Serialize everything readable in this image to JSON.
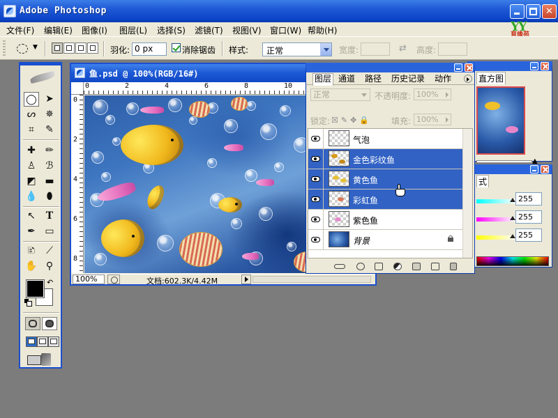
{
  "window": {
    "title": "Adobe Photoshop"
  },
  "menu": [
    "文件(F)",
    "编辑(E)",
    "图像(I)",
    "图层(L)",
    "选择(S)",
    "滤镜(T)",
    "视图(V)",
    "窗口(W)",
    "帮助(H)"
  ],
  "logo": {
    "letters": "YY",
    "text": "育缘苑"
  },
  "options": {
    "feather_label": "羽化:",
    "feather_value": "0 px",
    "antialias_label": "消除锯齿",
    "antialias_checked": true,
    "style_label": "样式:",
    "style_value": "正常",
    "width_label": "宽度:",
    "height_label": "高度:"
  },
  "document": {
    "title": "鱼.psd @ 100%(RGB/16#)",
    "ruler_h": [
      "0",
      "2",
      "4",
      "6",
      "8",
      "10"
    ],
    "ruler_v": [
      "0",
      "2",
      "4",
      "6",
      "8"
    ],
    "zoom": "100%",
    "doc_size": "文档:602.3K/4.42M"
  },
  "layers_panel": {
    "tabs": [
      "图层",
      "通道",
      "路径",
      "历史记录",
      "动作"
    ],
    "active_tab": "图层",
    "blend_mode": "正常",
    "opacity_label": "不透明度:",
    "opacity_value": "100%",
    "lock_label": "锁定:",
    "fill_label": "填充:",
    "fill_value": "100%",
    "layers": [
      {
        "name": "气泡",
        "selected": false,
        "visible": true
      },
      {
        "name": "金色彩纹鱼",
        "selected": true,
        "visible": true
      },
      {
        "name": "黄色鱼",
        "selected": true,
        "visible": true
      },
      {
        "name": "彩虹鱼",
        "selected": true,
        "visible": true
      },
      {
        "name": "紫色鱼",
        "selected": false,
        "visible": true
      },
      {
        "name": "背景",
        "selected": false,
        "visible": true,
        "locked": true
      }
    ]
  },
  "navigator_panel": {
    "tab": "直方图"
  },
  "color_panel": {
    "tab_fragment": "式",
    "r": "255",
    "g": "255",
    "b": "255"
  },
  "colors": {
    "foreground": "#000000",
    "background": "#ffffff",
    "selection": "#3162c4",
    "titlebar": "#1f59d6"
  }
}
